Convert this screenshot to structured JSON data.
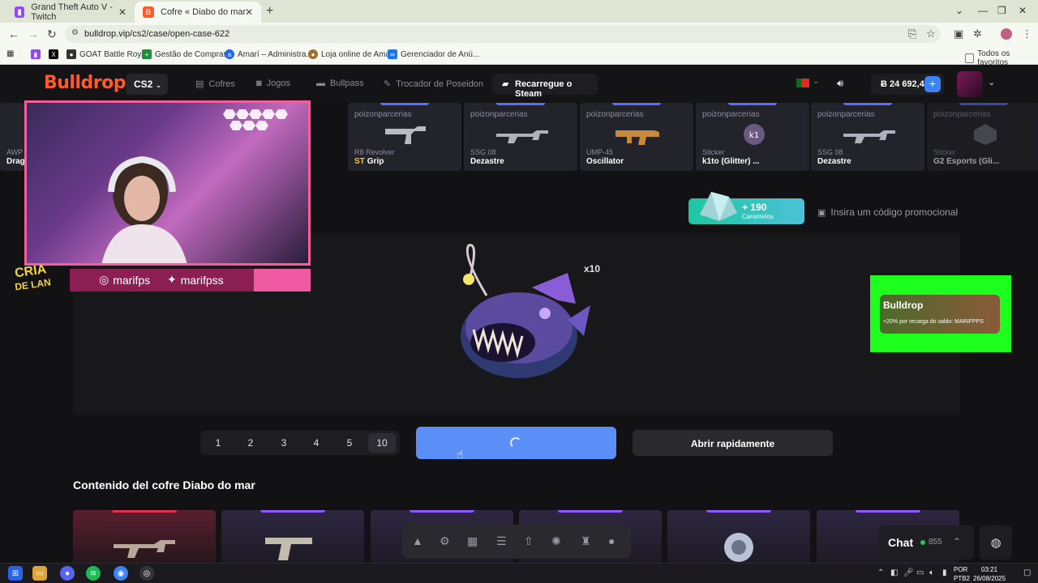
{
  "browser": {
    "tabs": [
      {
        "title": "Grand Theft Auto V - Twitch",
        "active": false
      },
      {
        "title": "Cofre « Diabo do mar » de Stan",
        "active": true
      }
    ],
    "url": "bulldrop.vip/cs2/case/open-case-622",
    "bookmarks": [
      "GOAT Battle Royale",
      "Gestão de Compras...",
      "Amarí – Administra...",
      "Loja online de Amarí",
      "Gerenciador de Anú..."
    ],
    "all_favorites": "Todos os favoritos"
  },
  "header": {
    "logo": "Bulldrop",
    "game": "CS2",
    "nav": [
      "Cofres",
      "Jogos",
      "Bullpass",
      "Trocador de Poseidon"
    ],
    "steam_button": "Recarregue o Steam",
    "balance": "Ƀ 24 692,4",
    "plus": "+"
  },
  "drops": [
    {
      "user": "poizonparcerias",
      "type": "R8 Revolver",
      "st": "ST",
      "name": "Grip"
    },
    {
      "user": "poizonparcerias",
      "type": "SSG 08",
      "st": "",
      "name": "Dezastre"
    },
    {
      "user": "poizonparcerias",
      "type": "UMP-45",
      "st": "",
      "name": "Oscillator"
    },
    {
      "user": "poizonparcerias",
      "type": "Sticker",
      "st": "",
      "name": "k1to (Glitter) ..."
    },
    {
      "user": "poizonparcerias",
      "type": "SSG 08",
      "st": "",
      "name": "Dezastre"
    },
    {
      "user": "poizonparcerias",
      "type": "Sticker",
      "st": "",
      "name": "G2 Esports (Gli..."
    }
  ],
  "drop_partial": {
    "type": "AWP",
    "name": "Drag"
  },
  "promo": {
    "caramel_amount": "+ 190",
    "caramel_label": "Caramelos",
    "code_placeholder": "Insira um código promocional"
  },
  "case": {
    "multiplier": "x10"
  },
  "overlay": {
    "instagram": "marifps",
    "twitter": "marifpss",
    "cria_line1": "CRIA",
    "cria_line2": "DE LAN",
    "ad_brand": "Bulldrop",
    "ad_text": "+20% por recarga do saldo: MARIFPPS"
  },
  "quantities": [
    "1",
    "2",
    "3",
    "4",
    "5",
    "10"
  ],
  "selected_quantity": "10",
  "fast_open": "Abrir rapidamente",
  "section_title": "Contenido del cofre Diabo do mar",
  "chat": {
    "label": "Chat",
    "count": "855"
  },
  "taskbar": {
    "lang1": "POR",
    "lang2": "PTB2",
    "time": "03:21",
    "date": "26/08/2025"
  },
  "colors": {
    "accent_blue": "#5b8ff7",
    "brand_orange": "#ff5a2c",
    "overlay_pink": "#f0609a",
    "ad_green": "#1dff1d",
    "online_green": "#22c55e"
  }
}
